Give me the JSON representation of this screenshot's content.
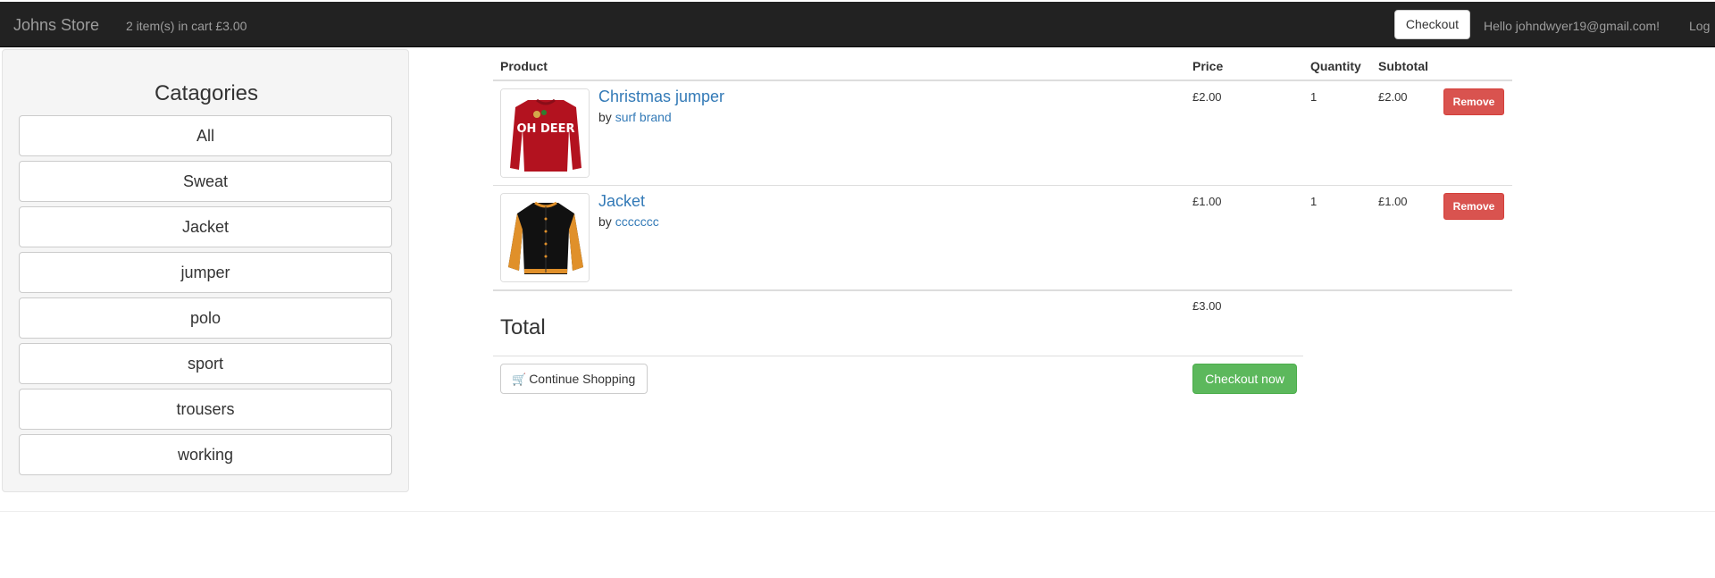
{
  "navbar": {
    "brand": "Johns Store",
    "cart_summary": "2 item(s) in cart £3.00",
    "checkout_label": "Checkout",
    "greeting": "Hello johndwyer19@gmail.com!",
    "logout_label": "Log"
  },
  "sidebar": {
    "title": "Catagories",
    "categories": [
      "All",
      "Sweat",
      "Jacket",
      "jumper",
      "polo",
      "sport",
      "trousers",
      "working"
    ]
  },
  "cart": {
    "headers": {
      "product": "Product",
      "price": "Price",
      "quantity": "Quantity",
      "subtotal": "Subtotal"
    },
    "items": [
      {
        "name": "Christmas jumper",
        "by_prefix": "by",
        "brand": "surf brand",
        "price": "£2.00",
        "quantity": "1",
        "subtotal": "£2.00",
        "remove_label": "Remove",
        "image_icon": "red-jumper-image",
        "image_text": "OH DEER"
      },
      {
        "name": "Jacket",
        "by_prefix": "by",
        "brand": "ccccccc",
        "price": "£1.00",
        "quantity": "1",
        "subtotal": "£1.00",
        "remove_label": "Remove",
        "image_icon": "varsity-jacket-image"
      }
    ],
    "total_label": "Total",
    "total_value": "£3.00",
    "continue_label": "Continue Shopping",
    "continue_icon": "shopping-cart-icon",
    "checkout_now_label": "Checkout now"
  },
  "colors": {
    "navbar_bg": "#222222",
    "link": "#337ab7",
    "danger": "#d9534f",
    "success": "#5cb85c"
  }
}
